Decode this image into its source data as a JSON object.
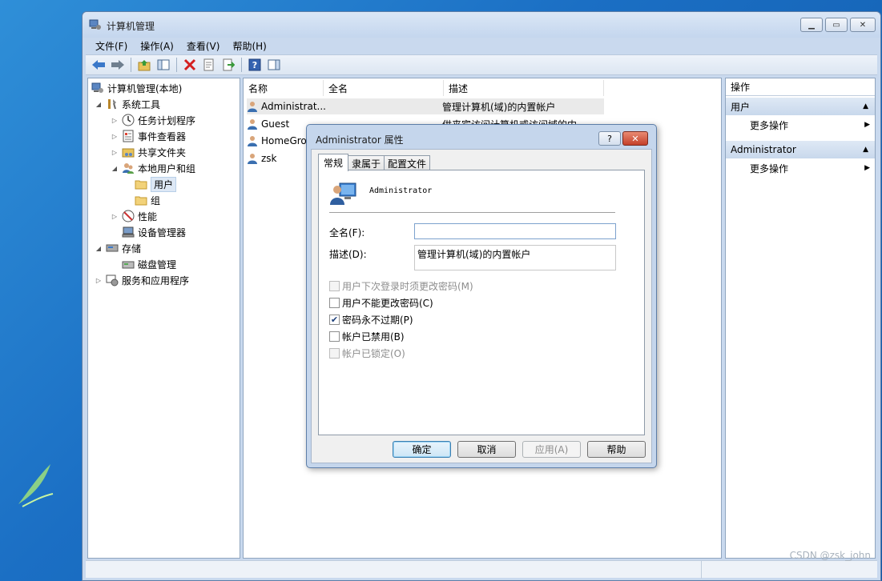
{
  "window": {
    "title": "计算机管理"
  },
  "menu": [
    "文件(F)",
    "操作(A)",
    "查看(V)",
    "帮助(H)"
  ],
  "tree": [
    {
      "label": "计算机管理(本地)",
      "level": 0,
      "exp": "",
      "icon": "computer-management-icon"
    },
    {
      "label": "系统工具",
      "level": 1,
      "exp": "▲",
      "icon": "system-tools-icon"
    },
    {
      "label": "任务计划程序",
      "level": 2,
      "exp": "▷",
      "icon": "clock-icon"
    },
    {
      "label": "事件查看器",
      "level": 2,
      "exp": "▷",
      "icon": "event-viewer-icon"
    },
    {
      "label": "共享文件夹",
      "level": 2,
      "exp": "▷",
      "icon": "shared-folder-icon"
    },
    {
      "label": "本地用户和组",
      "level": 2,
      "exp": "◢",
      "icon": "users-groups-icon"
    },
    {
      "label": "用户",
      "level": 3,
      "exp": "",
      "icon": "folder-icon",
      "selected": true
    },
    {
      "label": "组",
      "level": 3,
      "exp": "",
      "icon": "folder-icon"
    },
    {
      "label": "性能",
      "level": 2,
      "exp": "▷",
      "icon": "performance-icon"
    },
    {
      "label": "设备管理器",
      "level": 2,
      "exp": "",
      "icon": "device-manager-icon"
    },
    {
      "label": "存储",
      "level": 1,
      "exp": "◢",
      "icon": "storage-icon"
    },
    {
      "label": "磁盘管理",
      "level": 2,
      "exp": "",
      "icon": "disk-management-icon"
    },
    {
      "label": "服务和应用程序",
      "level": 1,
      "exp": "▷",
      "icon": "services-icon"
    }
  ],
  "list": {
    "columns": [
      "名称",
      "全名",
      "描述"
    ],
    "rows": [
      {
        "name": "Administrat...",
        "fullname": "",
        "desc": "管理计算机(域)的内置帐户"
      },
      {
        "name": "Guest",
        "fullname": "",
        "desc": "供来宾访问计算机或访问域的内"
      },
      {
        "name": "HomeGro",
        "fullname": "",
        "desc": ""
      },
      {
        "name": "zsk",
        "fullname": "",
        "desc": ""
      }
    ]
  },
  "actions": {
    "header": "操作",
    "sections": [
      {
        "title": "用户",
        "item": "更多操作"
      },
      {
        "title": "Administrator",
        "item": "更多操作"
      }
    ]
  },
  "dialog": {
    "title": "Administrator 属性",
    "help_btn": "?",
    "close_btn": "✕",
    "tabs": [
      "常规",
      "隶属于",
      "配置文件"
    ],
    "username": "Administrator",
    "fullname_label": "全名(F):",
    "fullname_value": "",
    "desc_label": "描述(D):",
    "desc_value": "管理计算机(域)的内置帐户",
    "checkboxes": [
      {
        "label": "用户下次登录时须更改密码(M)",
        "checked": false,
        "disabled": true
      },
      {
        "label": "用户不能更改密码(C)",
        "checked": false,
        "disabled": false
      },
      {
        "label": "密码永不过期(P)",
        "checked": true,
        "disabled": false
      },
      {
        "label": "帐户已禁用(B)",
        "checked": false,
        "disabled": false
      },
      {
        "label": "帐户已锁定(O)",
        "checked": false,
        "disabled": true
      }
    ],
    "buttons": {
      "ok": "确定",
      "cancel": "取消",
      "apply": "应用(A)",
      "help": "帮助"
    }
  },
  "watermark": "CSDN @zsk_john"
}
